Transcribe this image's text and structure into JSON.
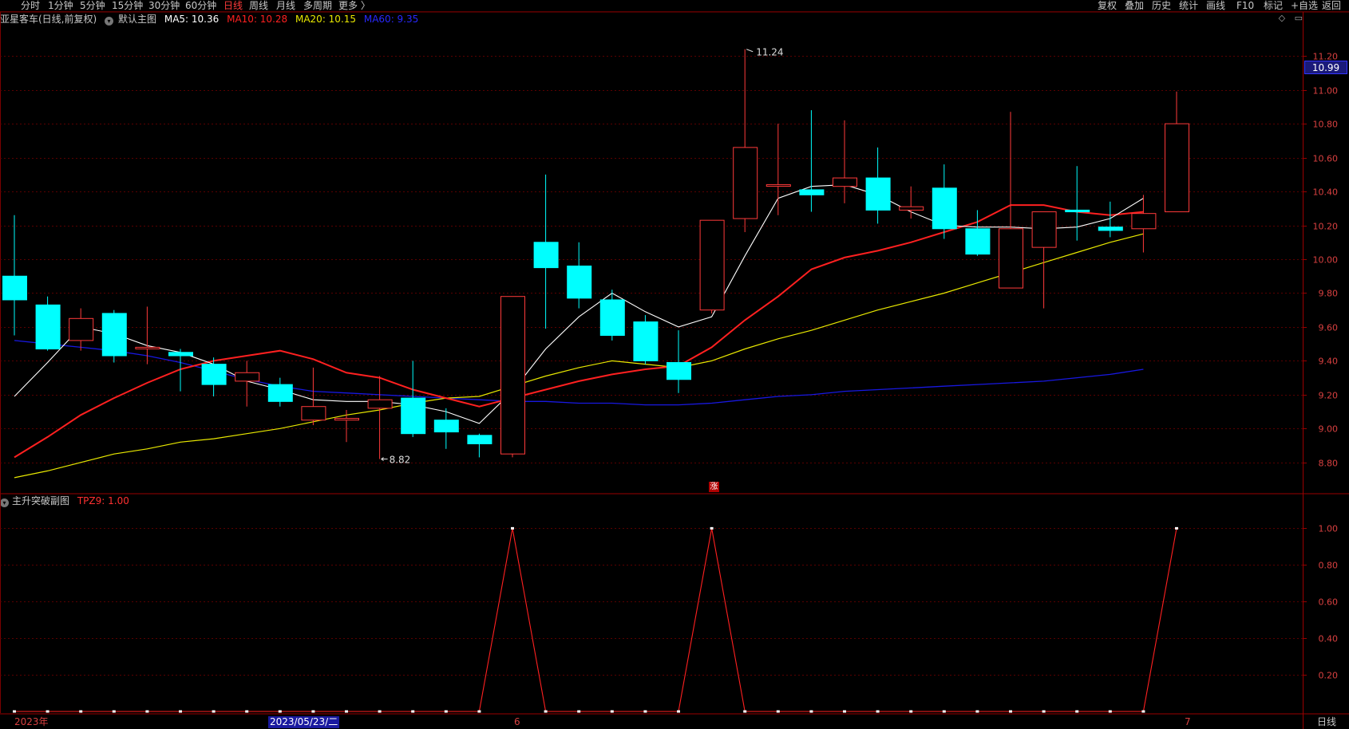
{
  "toolbar": {
    "timeframes": [
      "分时",
      "1分钟",
      "5分钟",
      "15分钟",
      "30分钟",
      "60分钟",
      "日线",
      "周线",
      "月线",
      "多周期",
      "更多 〉"
    ],
    "active_timeframe": "日线",
    "right_buttons": [
      "复权",
      "叠加",
      "历史",
      "统计",
      "画线",
      "F10",
      "标记",
      "+自选",
      "返回"
    ]
  },
  "main_legend": {
    "stock_title": "亚星客车(日线,前复权)",
    "chart_name": "默认主图",
    "ma5": "MA5: 10.36",
    "ma10": "MA10: 10.28",
    "ma20": "MA20: 10.15",
    "ma60": "MA60: 9.35"
  },
  "sub_legend": {
    "chart_name": "主升突破副图",
    "tpz9": "TPZ9: 1.00"
  },
  "colors": {
    "up": "#ff3a3a",
    "down": "#00ffff",
    "ma5": "#ffffff",
    "ma10": "#ff2020",
    "ma20": "#e8e800",
    "ma60": "#1818e0",
    "grid": "#5a0000",
    "axis_text": "#d84040"
  },
  "current_price": "10.99",
  "period_label": "日线",
  "zhang_badge": "涨",
  "annotations": {
    "high": "11.24",
    "low": "8.82"
  },
  "date_labels": [
    {
      "text": "2023年",
      "selected": false
    },
    {
      "text": "2023/05/23/二",
      "selected": true
    },
    {
      "text": "6",
      "selected": false
    },
    {
      "text": "7",
      "selected": false
    }
  ],
  "chart_data": {
    "type": "candlestick",
    "price_axis_ticks": [
      "11.20",
      "11.00",
      "10.80",
      "10.60",
      "10.40",
      "10.20",
      "10.00",
      "9.80",
      "9.60",
      "9.40",
      "9.20",
      "9.00",
      "8.80"
    ],
    "price_ylim": [
      8.62,
      11.38
    ],
    "candles": [
      {
        "o": 9.9,
        "h": 10.26,
        "l": 9.55,
        "c": 9.76
      },
      {
        "o": 9.73,
        "h": 9.78,
        "l": 9.46,
        "c": 9.47
      },
      {
        "o": 9.52,
        "h": 9.71,
        "l": 9.46,
        "c": 9.65
      },
      {
        "o": 9.68,
        "h": 9.7,
        "l": 9.39,
        "c": 9.43
      },
      {
        "o": 9.48,
        "h": 9.72,
        "l": 9.38,
        "c": 9.48
      },
      {
        "o": 9.45,
        "h": 9.47,
        "l": 9.22,
        "c": 9.43
      },
      {
        "o": 9.38,
        "h": 9.42,
        "l": 9.19,
        "c": 9.26
      },
      {
        "o": 9.28,
        "h": 9.4,
        "l": 9.13,
        "c": 9.33
      },
      {
        "o": 9.26,
        "h": 9.3,
        "l": 9.13,
        "c": 9.16
      },
      {
        "o": 9.05,
        "h": 9.36,
        "l": 9.02,
        "c": 9.13
      },
      {
        "o": 9.05,
        "h": 9.11,
        "l": 8.92,
        "c": 9.06
      },
      {
        "o": 9.12,
        "h": 9.31,
        "l": 8.82,
        "c": 9.17
      },
      {
        "o": 9.18,
        "h": 9.4,
        "l": 8.95,
        "c": 8.97
      },
      {
        "o": 9.05,
        "h": 9.12,
        "l": 8.88,
        "c": 8.98
      },
      {
        "o": 8.96,
        "h": 8.97,
        "l": 8.83,
        "c": 8.91
      },
      {
        "o": 8.85,
        "h": 9.78,
        "l": 8.83,
        "c": 9.78
      },
      {
        "o": 10.1,
        "h": 10.5,
        "l": 9.59,
        "c": 9.95
      },
      {
        "o": 9.96,
        "h": 10.1,
        "l": 9.71,
        "c": 9.77
      },
      {
        "o": 9.76,
        "h": 9.82,
        "l": 9.52,
        "c": 9.55
      },
      {
        "o": 9.63,
        "h": 9.67,
        "l": 9.38,
        "c": 9.4
      },
      {
        "o": 9.39,
        "h": 9.58,
        "l": 9.21,
        "c": 9.29
      },
      {
        "o": 9.7,
        "h": 10.23,
        "l": 9.68,
        "c": 10.23
      },
      {
        "o": 10.24,
        "h": 11.24,
        "l": 10.16,
        "c": 10.66
      },
      {
        "o": 10.44,
        "h": 10.8,
        "l": 10.26,
        "c": 10.44
      },
      {
        "o": 10.41,
        "h": 10.88,
        "l": 10.28,
        "c": 10.38
      },
      {
        "o": 10.43,
        "h": 10.82,
        "l": 10.33,
        "c": 10.48
      },
      {
        "o": 10.48,
        "h": 10.66,
        "l": 10.21,
        "c": 10.29
      },
      {
        "o": 10.29,
        "h": 10.43,
        "l": 10.24,
        "c": 10.31
      },
      {
        "o": 10.42,
        "h": 10.56,
        "l": 10.12,
        "c": 10.18
      },
      {
        "o": 10.18,
        "h": 10.29,
        "l": 10.02,
        "c": 10.03
      },
      {
        "o": 9.83,
        "h": 10.87,
        "l": 9.83,
        "c": 10.18
      },
      {
        "o": 10.07,
        "h": 10.28,
        "l": 9.71,
        "c": 10.28
      },
      {
        "o": 10.29,
        "h": 10.55,
        "l": 10.11,
        "c": 10.28
      },
      {
        "o": 10.19,
        "h": 10.34,
        "l": 10.13,
        "c": 10.17
      },
      {
        "o": 10.18,
        "h": 10.38,
        "l": 10.04,
        "c": 10.27
      },
      {
        "o": 10.28,
        "h": 10.99,
        "l": 10.28,
        "c": 10.8
      }
    ],
    "ma5": [
      9.19,
      9.39,
      9.6,
      9.56,
      9.49,
      9.45,
      9.38,
      9.28,
      9.23,
      9.17,
      9.16,
      9.16,
      9.14,
      9.1,
      9.03,
      9.22,
      9.47,
      9.66,
      9.8,
      9.69,
      9.6,
      9.66,
      10.02,
      10.36,
      10.43,
      10.44,
      10.38,
      10.28,
      10.2,
      10.19,
      10.19,
      10.18,
      10.19,
      10.24,
      10.36
    ],
    "ma10": [
      8.83,
      8.95,
      9.08,
      9.18,
      9.27,
      9.35,
      9.4,
      9.43,
      9.46,
      9.41,
      9.33,
      9.3,
      9.23,
      9.18,
      9.13,
      9.18,
      9.23,
      9.28,
      9.32,
      9.35,
      9.37,
      9.48,
      9.64,
      9.78,
      9.94,
      10.01,
      10.05,
      10.1,
      10.16,
      10.22,
      10.32,
      10.32,
      10.28,
      10.26,
      10.28
    ],
    "ma20": [
      8.71,
      8.75,
      8.8,
      8.85,
      8.88,
      8.92,
      8.94,
      8.97,
      9.0,
      9.04,
      9.08,
      9.11,
      9.15,
      9.18,
      9.19,
      9.25,
      9.31,
      9.36,
      9.4,
      9.38,
      9.36,
      9.4,
      9.47,
      9.53,
      9.58,
      9.64,
      9.7,
      9.75,
      9.8,
      9.86,
      9.92,
      9.98,
      10.04,
      10.1,
      10.15
    ],
    "ma60": [
      9.52,
      9.5,
      9.48,
      9.46,
      9.43,
      9.39,
      9.34,
      9.29,
      9.25,
      9.22,
      9.21,
      9.2,
      9.19,
      9.18,
      9.17,
      9.16,
      9.16,
      9.15,
      9.15,
      9.14,
      9.14,
      9.15,
      9.17,
      9.19,
      9.2,
      9.22,
      9.23,
      9.24,
      9.25,
      9.26,
      9.27,
      9.28,
      9.3,
      9.32,
      9.35
    ],
    "sub_axis_ticks": [
      "1.00",
      "0.80",
      "0.60",
      "0.40",
      "0.20"
    ],
    "sub_ylim": [
      0,
      1.08
    ],
    "tpz9": [
      0,
      0,
      0,
      0,
      0,
      0,
      0,
      0,
      0,
      0,
      0,
      0,
      0,
      0,
      0,
      1,
      0,
      0,
      0,
      0,
      0,
      1,
      0,
      0,
      0,
      0,
      0,
      0,
      0,
      0,
      0,
      0,
      0,
      0,
      0,
      1
    ]
  }
}
